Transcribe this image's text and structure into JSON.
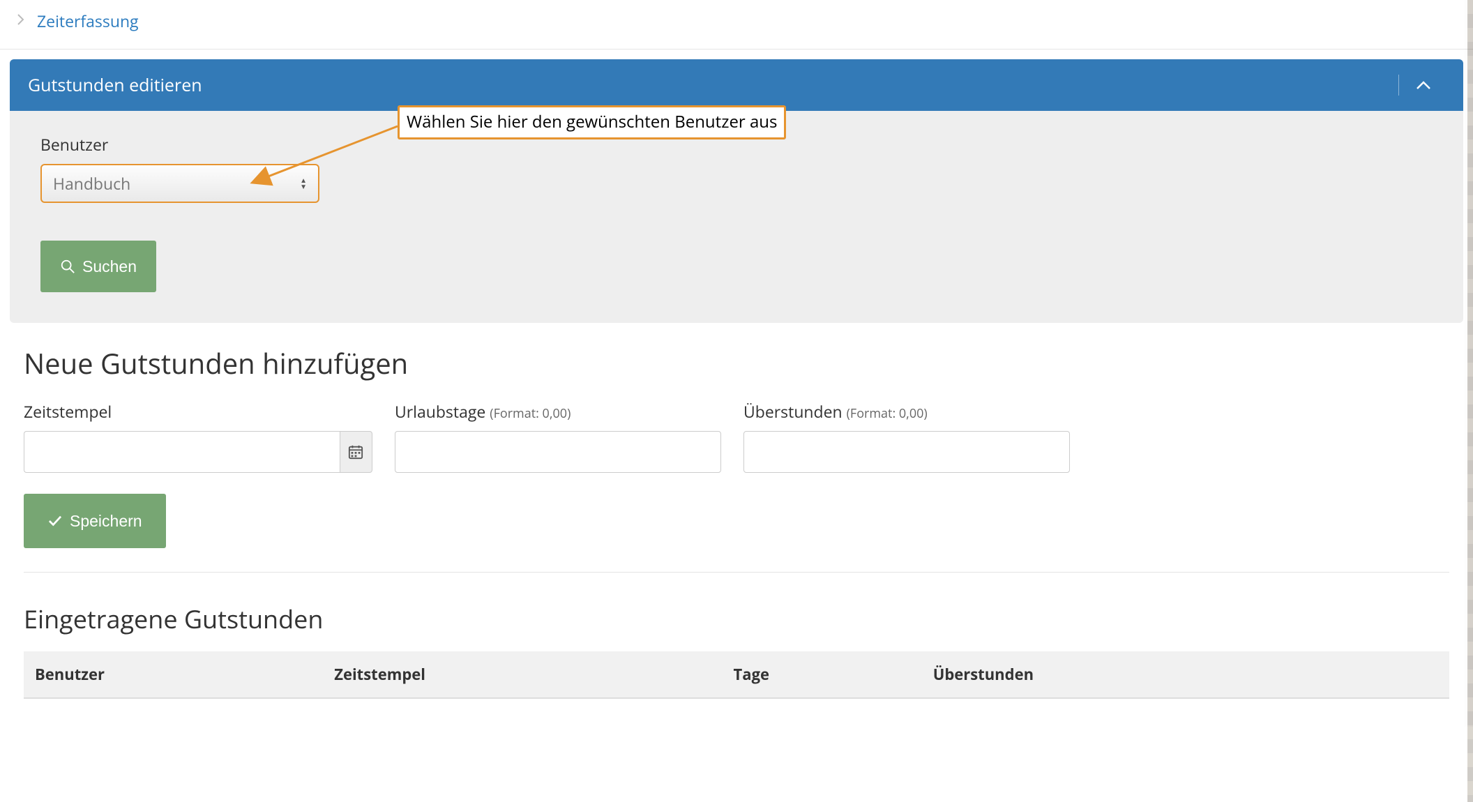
{
  "breadcrumb": {
    "label": "Zeiterfassung"
  },
  "panel": {
    "title": "Gutstunden editieren",
    "user_label": "Benutzer",
    "user_selected": "Handbuch",
    "search_label": "Suchen"
  },
  "annotation": {
    "text": "Wählen Sie hier den gewünschten Benutzer aus"
  },
  "add_section": {
    "heading": "Neue Gutstunden hinzufügen",
    "timestamp_label": "Zeitstempel",
    "vacation_label": "Urlaubstage",
    "vacation_hint": "(Format: 0,00)",
    "overtime_label": "Überstunden",
    "overtime_hint": "(Format: 0,00)",
    "save_label": "Speichern"
  },
  "list_section": {
    "heading": "Eingetragene Gutstunden",
    "columns": {
      "user": "Benutzer",
      "timestamp": "Zeitstempel",
      "days": "Tage",
      "overtime": "Überstunden"
    }
  }
}
